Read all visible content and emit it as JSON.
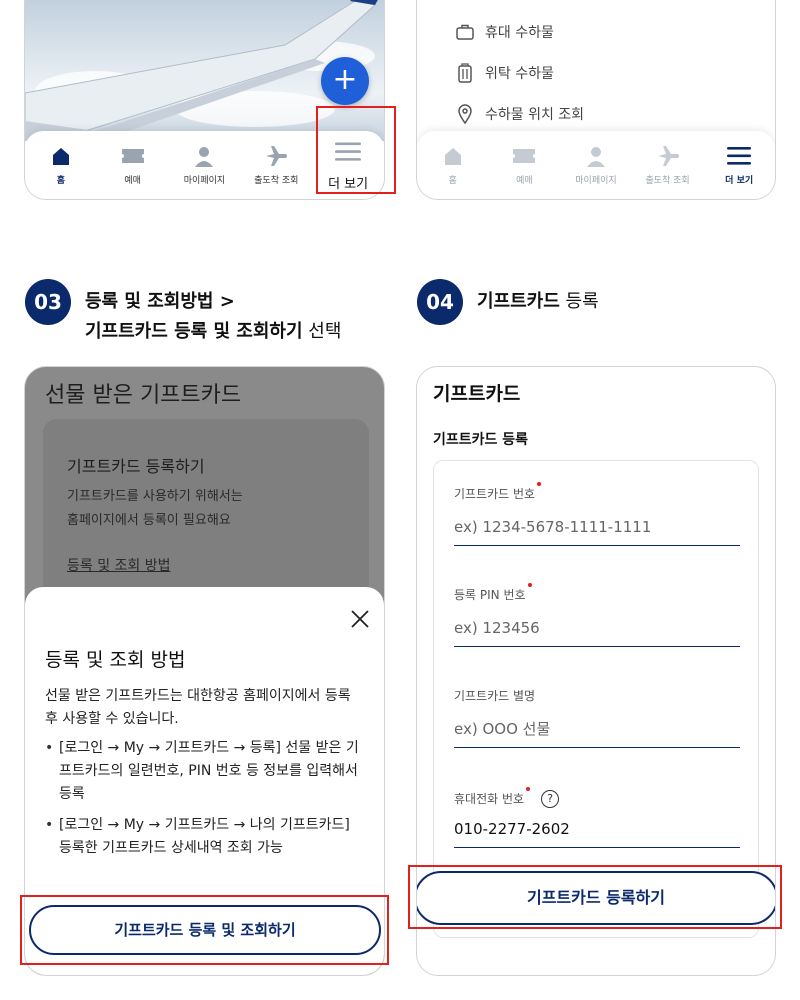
{
  "tabbar_left": {
    "items": [
      {
        "label": "홈",
        "icon": "home-icon",
        "state": "active"
      },
      {
        "label": "예매",
        "icon": "ticket-icon",
        "state": "normal"
      },
      {
        "label": "마이페이지",
        "icon": "person-icon",
        "state": "normal"
      },
      {
        "label": "출도착 조회",
        "icon": "airplane-icon",
        "state": "normal"
      }
    ],
    "more_label": "더 보기",
    "fab_symbol": "+"
  },
  "phone2": {
    "menu": [
      {
        "label": "휴대 수하물",
        "icon": "carry-on-bag-icon"
      },
      {
        "label": "위탁 수하물",
        "icon": "luggage-icon"
      },
      {
        "label": "수하물 위치 조회",
        "icon": "location-pin-icon"
      }
    ],
    "tabbar": [
      {
        "label": "홈",
        "icon": "home-icon"
      },
      {
        "label": "예매",
        "icon": "ticket-icon"
      },
      {
        "label": "마이페이지",
        "icon": "person-icon"
      },
      {
        "label": "출도착 조회",
        "icon": "airplane-icon"
      },
      {
        "label": "더 보기",
        "icon": "menu-icon"
      }
    ]
  },
  "step3": {
    "number": "03",
    "line1": "등록 및 조회방법 >",
    "line2_bold": "기프트카드 등록 및 조회하기",
    "line2_rest": " 선택"
  },
  "step4": {
    "number": "04",
    "bold": "기프트카드",
    "rest": " 등록"
  },
  "phone3": {
    "page_title": "선물 받은 기프트카드",
    "card_title": "기프트카드 등록하기",
    "card_desc_1": "기프트카드를 사용하기 위해서는",
    "card_desc_2": "홈페이지에서 등록이 필요해요",
    "card_link": "등록 및 조회 방법",
    "sheet_title": "등록 및 조회 방법",
    "sheet_intro": "선물 받은 기프트카드는 대한항공 홈페이지에서 등록 후 사용할 수 있습니다.",
    "bullets": [
      "[로그인 → My → 기프트카드 → 등록] 선물 받은 기프트카드의 일련번호, PIN 번호 등 정보를 입력해서 등록",
      "[로그인 → My → 기프트카드 → 나의 기프트카드] 등록한 기프트카드 상세내역 조회 가능"
    ],
    "button": "기프트카드 등록 및 조회하기"
  },
  "phone4": {
    "title": "기프트카드",
    "subtitle": "기프트카드 등록",
    "fields": [
      {
        "label": "기프트카드 번호",
        "placeholder": "ex) 1234-5678-1111-1111",
        "required": true
      },
      {
        "label": "등록 PIN 번호",
        "placeholder": "ex) 123456",
        "required": true
      },
      {
        "label": "기프트카드 별명",
        "placeholder": "ex) OOO 선물",
        "required": false
      },
      {
        "label": "휴대전화 번호",
        "value": "010-2277-2602",
        "required": true,
        "help": "?"
      }
    ],
    "button": "기프트카드 등록하기"
  },
  "colors": {
    "navy": "#0b2a6b",
    "highlight_red": "#e0211c",
    "fab_blue": "#1f5fd8"
  }
}
